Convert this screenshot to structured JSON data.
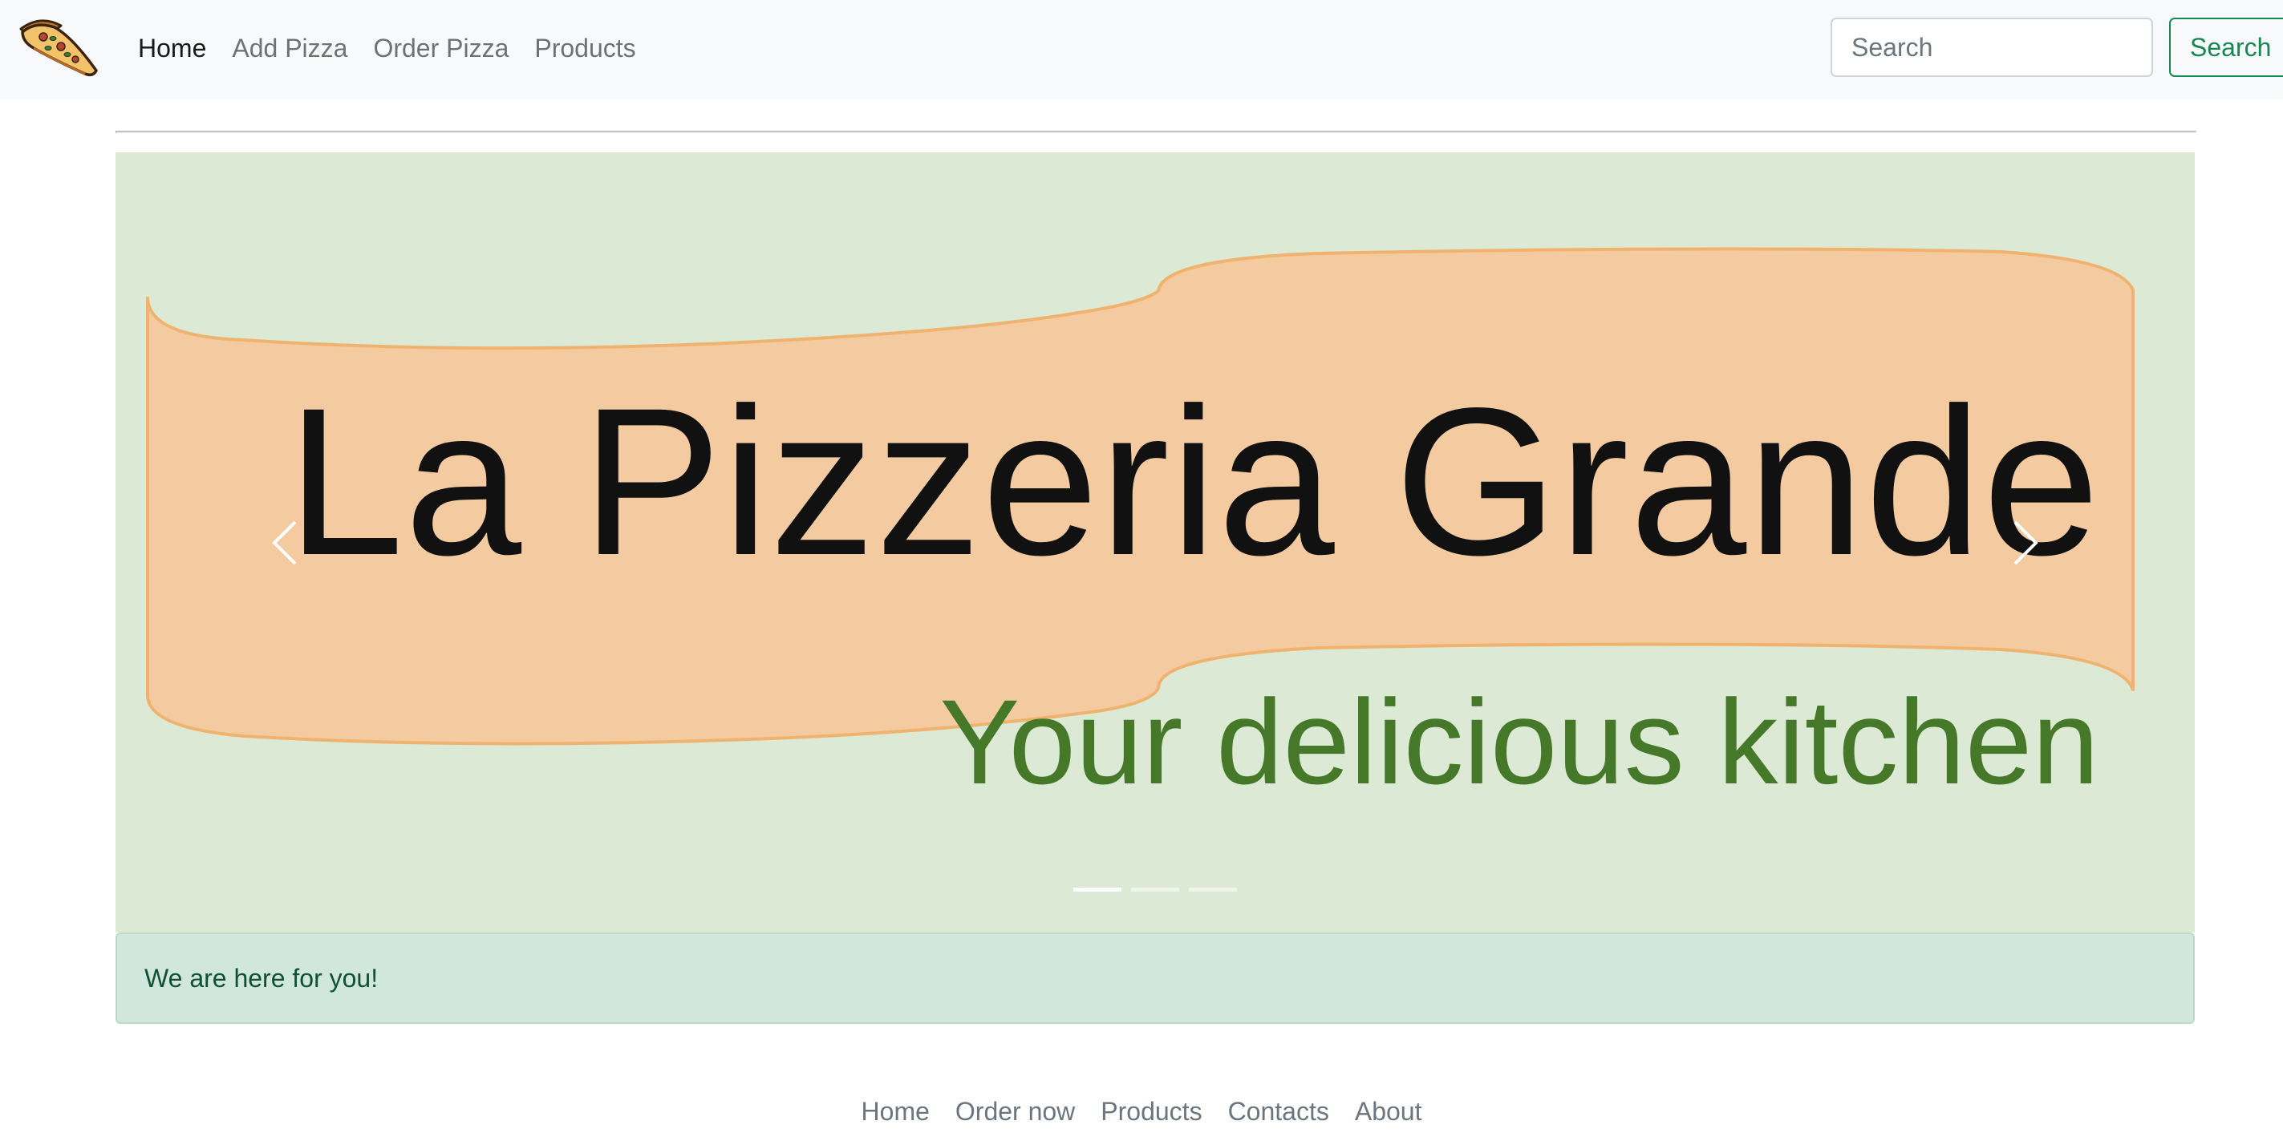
{
  "navbar": {
    "logo_icon": "pizza-slice-icon",
    "links": [
      {
        "label": "Home",
        "active": true
      },
      {
        "label": "Add Pizza",
        "active": false
      },
      {
        "label": "Order Pizza",
        "active": false
      },
      {
        "label": "Products",
        "active": false
      }
    ],
    "search": {
      "placeholder": "Search",
      "value": "",
      "button_label": "Search"
    }
  },
  "carousel": {
    "title": "La Pizzeria Grande",
    "subtitle": "Your delicious kitchen",
    "prev_icon": "chevron-left-icon",
    "next_icon": "chevron-right-icon",
    "slide_count": 3,
    "active_slide": 1
  },
  "alert": {
    "text": "We are here for you!"
  },
  "footer": {
    "links": [
      "Home",
      "Order now",
      "Products",
      "Contacts",
      "About"
    ]
  },
  "colors": {
    "navbar_bg": "#f8f9fa",
    "banner_bg": "#dce9d5",
    "ribbon_fill": "#f4cba1",
    "ribbon_stroke": "#f0b36f",
    "subtitle_green": "#467829",
    "success": "#198754",
    "alert_bg": "#d1e7dd",
    "alert_text": "#0f5132"
  }
}
